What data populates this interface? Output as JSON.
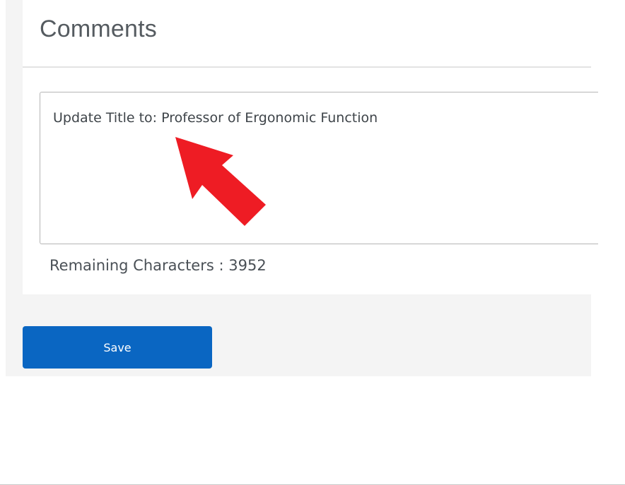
{
  "comments_section": {
    "title": "Comments",
    "comment_value": "Update Title to: Professor of Ergonomic Function",
    "remaining_label": "Remaining Characters : 3952",
    "remaining_count": 3952
  },
  "annotation": {
    "icon": "arrow-pointer-icon",
    "color": "#ee1c24"
  },
  "actions": {
    "save_label": "Save"
  },
  "colors": {
    "primary_button": "#0a66c2",
    "page_background": "#f4f4f4",
    "card_background": "#ffffff"
  }
}
